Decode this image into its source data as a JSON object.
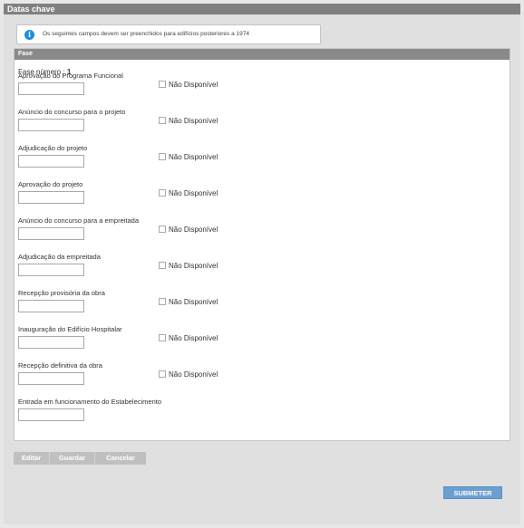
{
  "section": {
    "title": "Datas chave"
  },
  "info": {
    "icon": "info-icon",
    "text": "Os seguintes campos devem ser preenchidos para edifícios posteriores a 1974"
  },
  "fase": {
    "header": "Fase",
    "numero_label": "Fase número :",
    "numero_value": "1",
    "nd_label": "Não Disponível",
    "fields": [
      {
        "label": "Aprovação do Programa Funcional",
        "value": "",
        "has_nd": true
      },
      {
        "label": "Anúncio do concurso para o projeto",
        "value": "",
        "has_nd": true
      },
      {
        "label": "Adjudicação do projeto",
        "value": "",
        "has_nd": true
      },
      {
        "label": "Aprovação do projeto",
        "value": "",
        "has_nd": true
      },
      {
        "label": "Anúncio do concurso para a empreitada",
        "value": "",
        "has_nd": true
      },
      {
        "label": "Adjudicação da empreitada",
        "value": "",
        "has_nd": true
      },
      {
        "label": "Recepção provisória da obra",
        "value": "",
        "has_nd": true
      },
      {
        "label": "Inauguração do Edifício Hospitalar",
        "value": "",
        "has_nd": true
      },
      {
        "label": "Recepção definitiva da obra",
        "value": "",
        "has_nd": true
      },
      {
        "label": "Entrada em funcionamento do Estabelecimento",
        "value": "",
        "has_nd": false
      }
    ]
  },
  "actions": {
    "editar": "Editar",
    "guardar": "Guardar",
    "cancelar": "Cancelar",
    "submeter": "SUBMETER"
  },
  "colors": {
    "title_bar": "#808080",
    "fase_header": "#8a8a8a",
    "info_icon": "#1a8fd8",
    "submit": "#6a9fd0",
    "secondary_button": "#c0c0c0"
  }
}
